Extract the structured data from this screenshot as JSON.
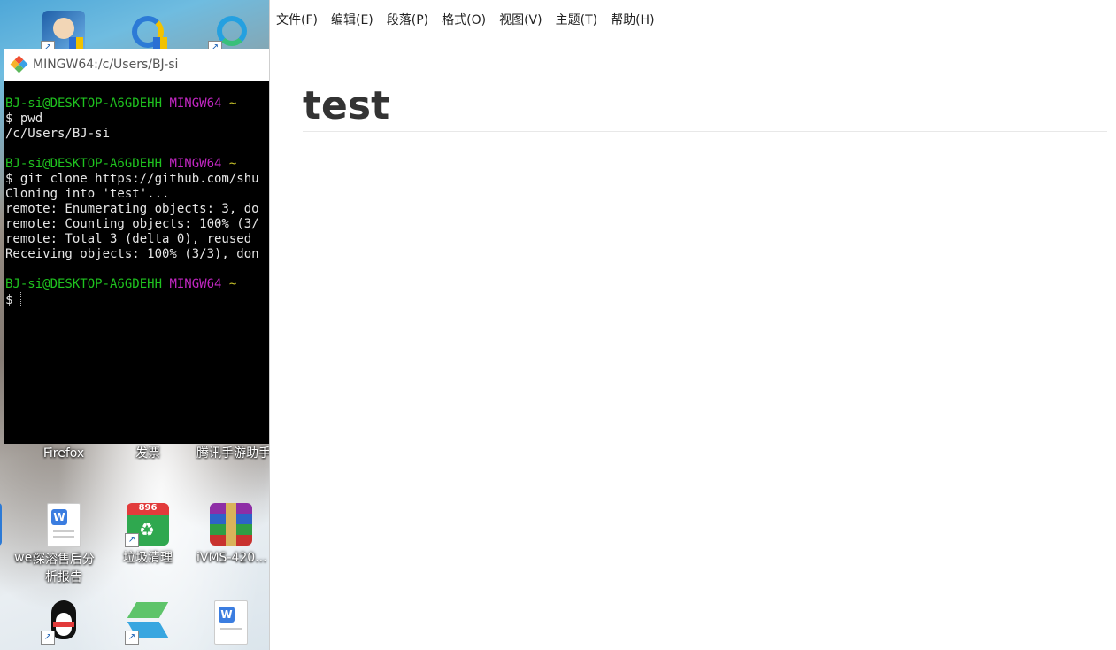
{
  "desktop": {
    "top_icons": [
      {
        "name": "icon-1",
        "label": ""
      },
      {
        "name": "icon-2",
        "label": ""
      },
      {
        "name": "icon-3",
        "label": ""
      }
    ],
    "row1_labels": [
      "Firefox",
      "发票",
      "腾讯手游助手"
    ],
    "row2_labels": [
      "wer",
      "深溶售后分析报告",
      "垃圾清理",
      "iVMS-420..."
    ],
    "badge_896": "896"
  },
  "terminal": {
    "title": "MINGW64:/c/Users/BJ-si",
    "user_host": "BJ-si@DESKTOP-A6GDEHH",
    "env": "MINGW64",
    "path": "~",
    "lines": [
      {
        "type": "prompt"
      },
      {
        "type": "cmd",
        "text": "$ pwd"
      },
      {
        "type": "out",
        "text": "/c/Users/BJ-si"
      },
      {
        "type": "blank"
      },
      {
        "type": "prompt"
      },
      {
        "type": "cmd",
        "text": "$ git clone https://github.com/shu"
      },
      {
        "type": "out",
        "text": "Cloning into 'test'..."
      },
      {
        "type": "out",
        "text": "remote: Enumerating objects: 3, do"
      },
      {
        "type": "out",
        "text": "remote: Counting objects: 100% (3/"
      },
      {
        "type": "out",
        "text": "remote: Total 3 (delta 0), reused"
      },
      {
        "type": "out",
        "text": "Receiving objects: 100% (3/3), don"
      },
      {
        "type": "blank"
      },
      {
        "type": "prompt"
      },
      {
        "type": "cmd",
        "text": "$ "
      }
    ]
  },
  "editor": {
    "menu": [
      "文件(F)",
      "编辑(E)",
      "段落(P)",
      "格式(O)",
      "视图(V)",
      "主题(T)",
      "帮助(H)"
    ],
    "heading": "test"
  }
}
